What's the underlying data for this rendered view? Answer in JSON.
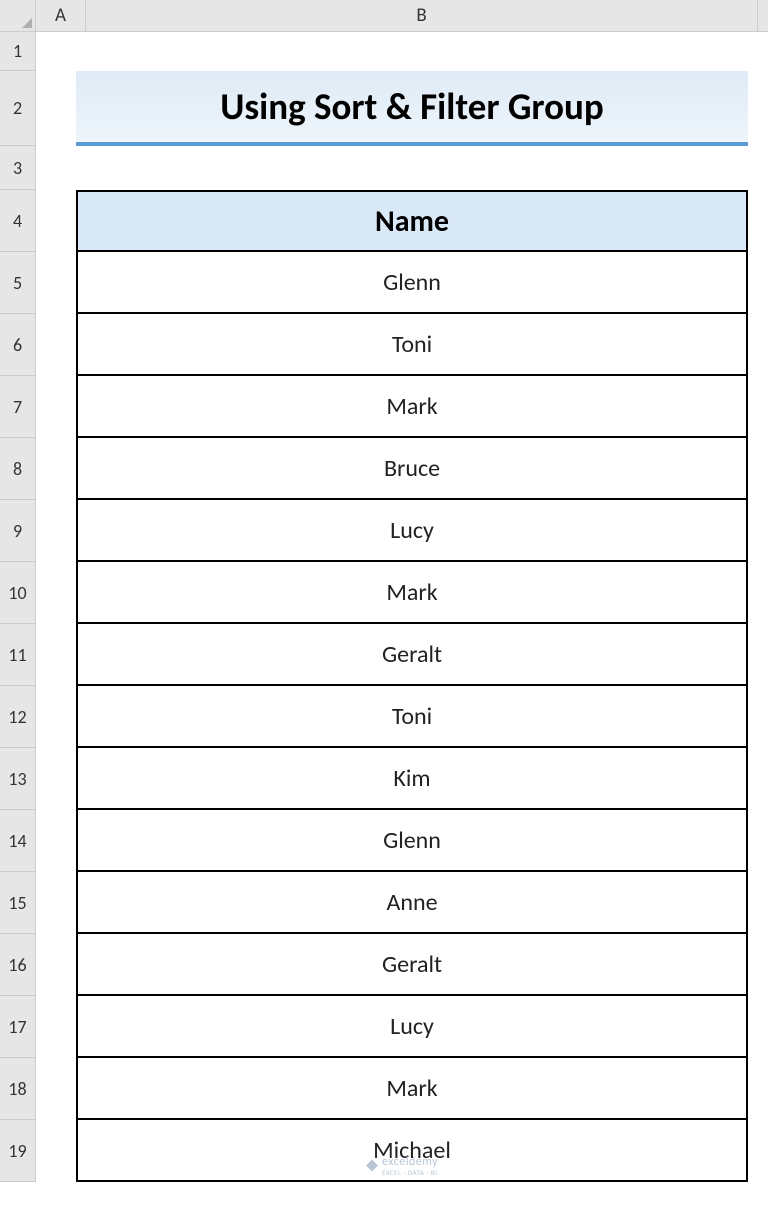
{
  "columns": {
    "A": "A",
    "B": "B"
  },
  "rows": [
    "1",
    "2",
    "3",
    "4",
    "5",
    "6",
    "7",
    "8",
    "9",
    "10",
    "11",
    "12",
    "13",
    "14",
    "15",
    "16",
    "17",
    "18",
    "19"
  ],
  "title": "Using Sort & Filter Group",
  "tableHeader": "Name",
  "names": [
    "Glenn",
    "Toni",
    "Mark",
    "Bruce",
    "Lucy",
    "Mark",
    "Geralt",
    "Toni",
    "Kim",
    "Glenn",
    "Anne",
    "Geralt",
    "Lucy",
    "Mark",
    "Michael"
  ],
  "watermark": {
    "brand": "exceldemy",
    "sub": "EXCEL · DATA · BI"
  }
}
